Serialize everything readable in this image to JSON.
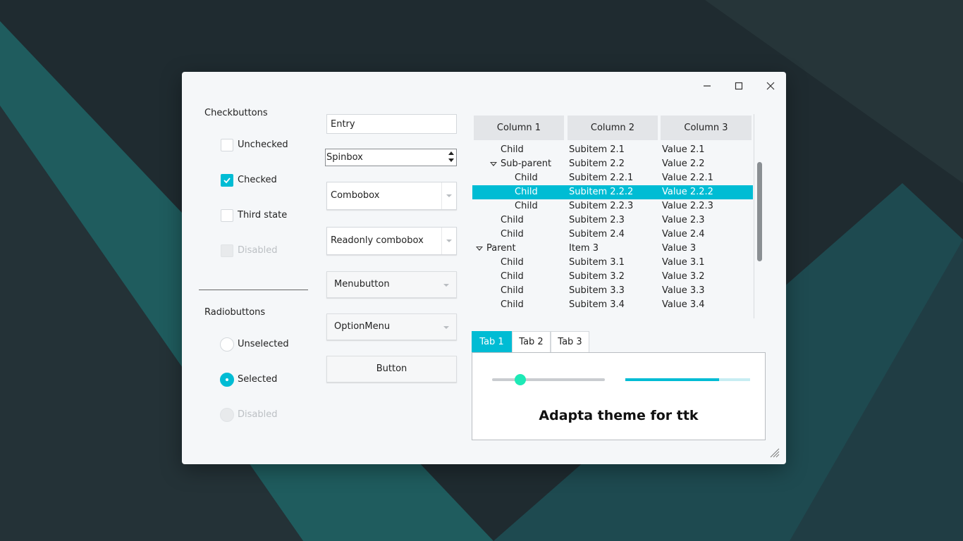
{
  "window": {
    "controls": {
      "minimize": "minimize",
      "maximize": "maximize",
      "close": "close"
    }
  },
  "checkbuttons": {
    "title": "Checkbuttons",
    "items": [
      {
        "label": "Unchecked",
        "state": "unchecked"
      },
      {
        "label": "Checked",
        "state": "checked"
      },
      {
        "label": "Third state",
        "state": "unchecked"
      },
      {
        "label": "Disabled",
        "state": "disabled"
      }
    ]
  },
  "radiobuttons": {
    "title": "Radiobuttons",
    "items": [
      {
        "label": "Unselected",
        "state": "unselected"
      },
      {
        "label": "Selected",
        "state": "selected"
      },
      {
        "label": "Disabled",
        "state": "disabled"
      }
    ]
  },
  "widgets": {
    "entry_value": "Entry",
    "spinbox_value": "Spinbox",
    "combobox_value": "Combobox",
    "readonly_combobox_value": "Readonly combobox",
    "menubutton_label": "Menubutton",
    "optionmenu_label": "OptionMenu",
    "button_label": "Button"
  },
  "tree": {
    "columns": [
      "Column 1",
      "Column 2",
      "Column 3"
    ],
    "rows": [
      {
        "c1": "Child",
        "c2": "Subitem 2.1",
        "c3": "Value 2.1",
        "level": 2,
        "expander": false,
        "selected": false
      },
      {
        "c1": "Sub-parent",
        "c2": "Subitem 2.2",
        "c3": "Value 2.2",
        "level": 2,
        "expander": true,
        "selected": false
      },
      {
        "c1": "Child",
        "c2": "Subitem 2.2.1",
        "c3": "Value 2.2.1",
        "level": 3,
        "expander": false,
        "selected": false
      },
      {
        "c1": "Child",
        "c2": "Subitem 2.2.2",
        "c3": "Value 2.2.2",
        "level": 3,
        "expander": false,
        "selected": true
      },
      {
        "c1": "Child",
        "c2": "Subitem 2.2.3",
        "c3": "Value 2.2.3",
        "level": 3,
        "expander": false,
        "selected": false
      },
      {
        "c1": "Child",
        "c2": "Subitem 2.3",
        "c3": "Value 2.3",
        "level": 2,
        "expander": false,
        "selected": false
      },
      {
        "c1": "Child",
        "c2": "Subitem 2.4",
        "c3": "Value 2.4",
        "level": 2,
        "expander": false,
        "selected": false
      },
      {
        "c1": "Parent",
        "c2": "Item 3",
        "c3": "Value 3",
        "level": 1,
        "expander": true,
        "selected": false
      },
      {
        "c1": "Child",
        "c2": "Subitem 3.1",
        "c3": "Value 3.1",
        "level": 2,
        "expander": false,
        "selected": false
      },
      {
        "c1": "Child",
        "c2": "Subitem 3.2",
        "c3": "Value 3.2",
        "level": 2,
        "expander": false,
        "selected": false
      },
      {
        "c1": "Child",
        "c2": "Subitem 3.3",
        "c3": "Value 3.3",
        "level": 2,
        "expander": false,
        "selected": false
      },
      {
        "c1": "Child",
        "c2": "Subitem 3.4",
        "c3": "Value 3.4",
        "level": 2,
        "expander": false,
        "selected": false
      }
    ]
  },
  "tabs": {
    "items": [
      "Tab 1",
      "Tab 2",
      "Tab 3"
    ],
    "active_index": 0,
    "slider_value": 0.25,
    "progress_value": 0.75,
    "caption": "Adapta theme for ttk"
  },
  "colors": {
    "accent": "#00bcd4",
    "slider_thumb": "#1de9b6",
    "window_bg": "#f5f7f9",
    "desktop_dark": "#1f2b30",
    "desktop_teal": "#1f5c5e"
  }
}
